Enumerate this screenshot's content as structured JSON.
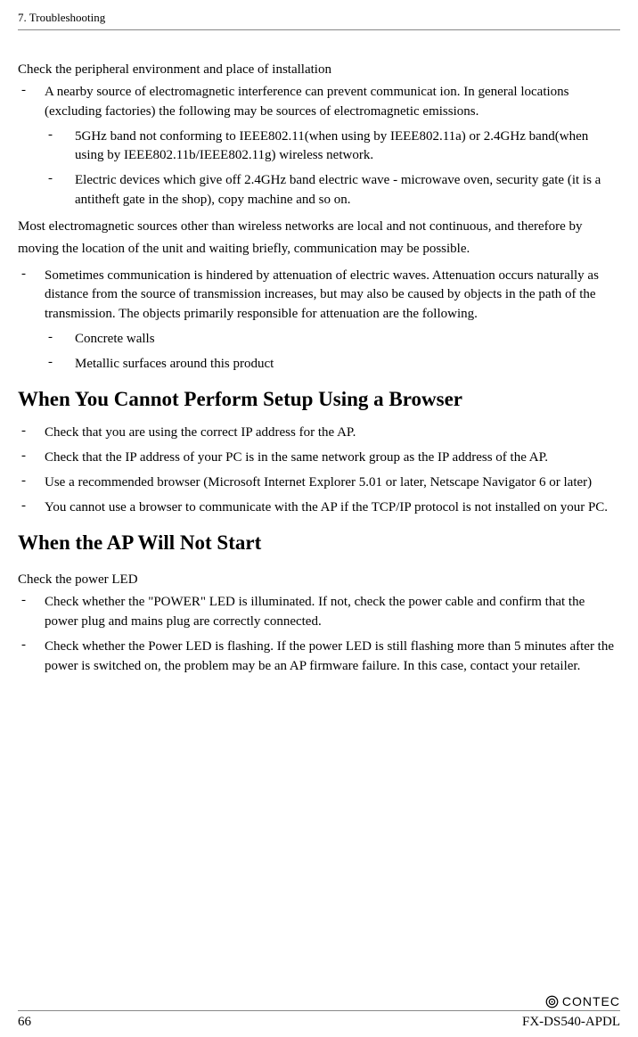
{
  "header": "7. Troubleshooting",
  "s1": {
    "lead": "Check the peripheral environment and place of installation",
    "b1": "A nearby source of electromagnetic interference can prevent communicat ion.  In general locations (excluding factories) the following may be sources of electromagnetic emissions.",
    "b1a": "5GHz band not conforming to IEEE802.11(when using by IEEE802.11a) or 2.4GHz band(when using by IEEE802.11b/IEEE802.11g) wireless network.",
    "b1b": "Electric devices which give off 2.4GHz band electric wave - microwave oven, security gate (it is a antitheft gate in the shop), copy machine and so on.",
    "p1": "Most electromagnetic sources other than wireless networks are local and not continuous, and therefore by moving the location of the unit and waiting briefly, communication may be possible.",
    "b2": "Sometimes communication is hindered by attenuation of electric waves.  Attenuation occurs naturally as distance from the source of transmission increases, but may also be caused by objects in the path of the transmission.  The objects primarily responsible for attenuation are the following.",
    "b2a": "Concrete walls",
    "b2b": "Metallic surfaces around this product"
  },
  "s2": {
    "title": "When You Cannot Perform Setup Using a Browser",
    "b1": "Check that you are using the correct IP address for the AP.",
    "b2": "Check that the IP address of your PC is in the same network group as the IP address of the AP.",
    "b3": "Use a recommended browser (Microsoft Internet Explorer 5.01 or later, Netscape Navigator 6 or later)",
    "b4": "You cannot use a browser to communicate with the AP if the TCP/IP protocol is not installed on your PC."
  },
  "s3": {
    "title": "When the AP Will Not Start",
    "lead": "Check the power LED",
    "b1": "Check whether the \"POWER\" LED is illuminated.  If not, check the power cable and confirm that the power plug and mains plug are correctly connected.",
    "b2": "Check whether the Power LED is flashing.  If the power LED is still flashing more than 5 minutes after the power is switched on, the problem may be an AP firmware failure.  In this case, contact your retailer."
  },
  "footer": {
    "brand": "CONTEC",
    "page": "66",
    "model": "FX-DS540-APDL"
  },
  "dash": "-"
}
